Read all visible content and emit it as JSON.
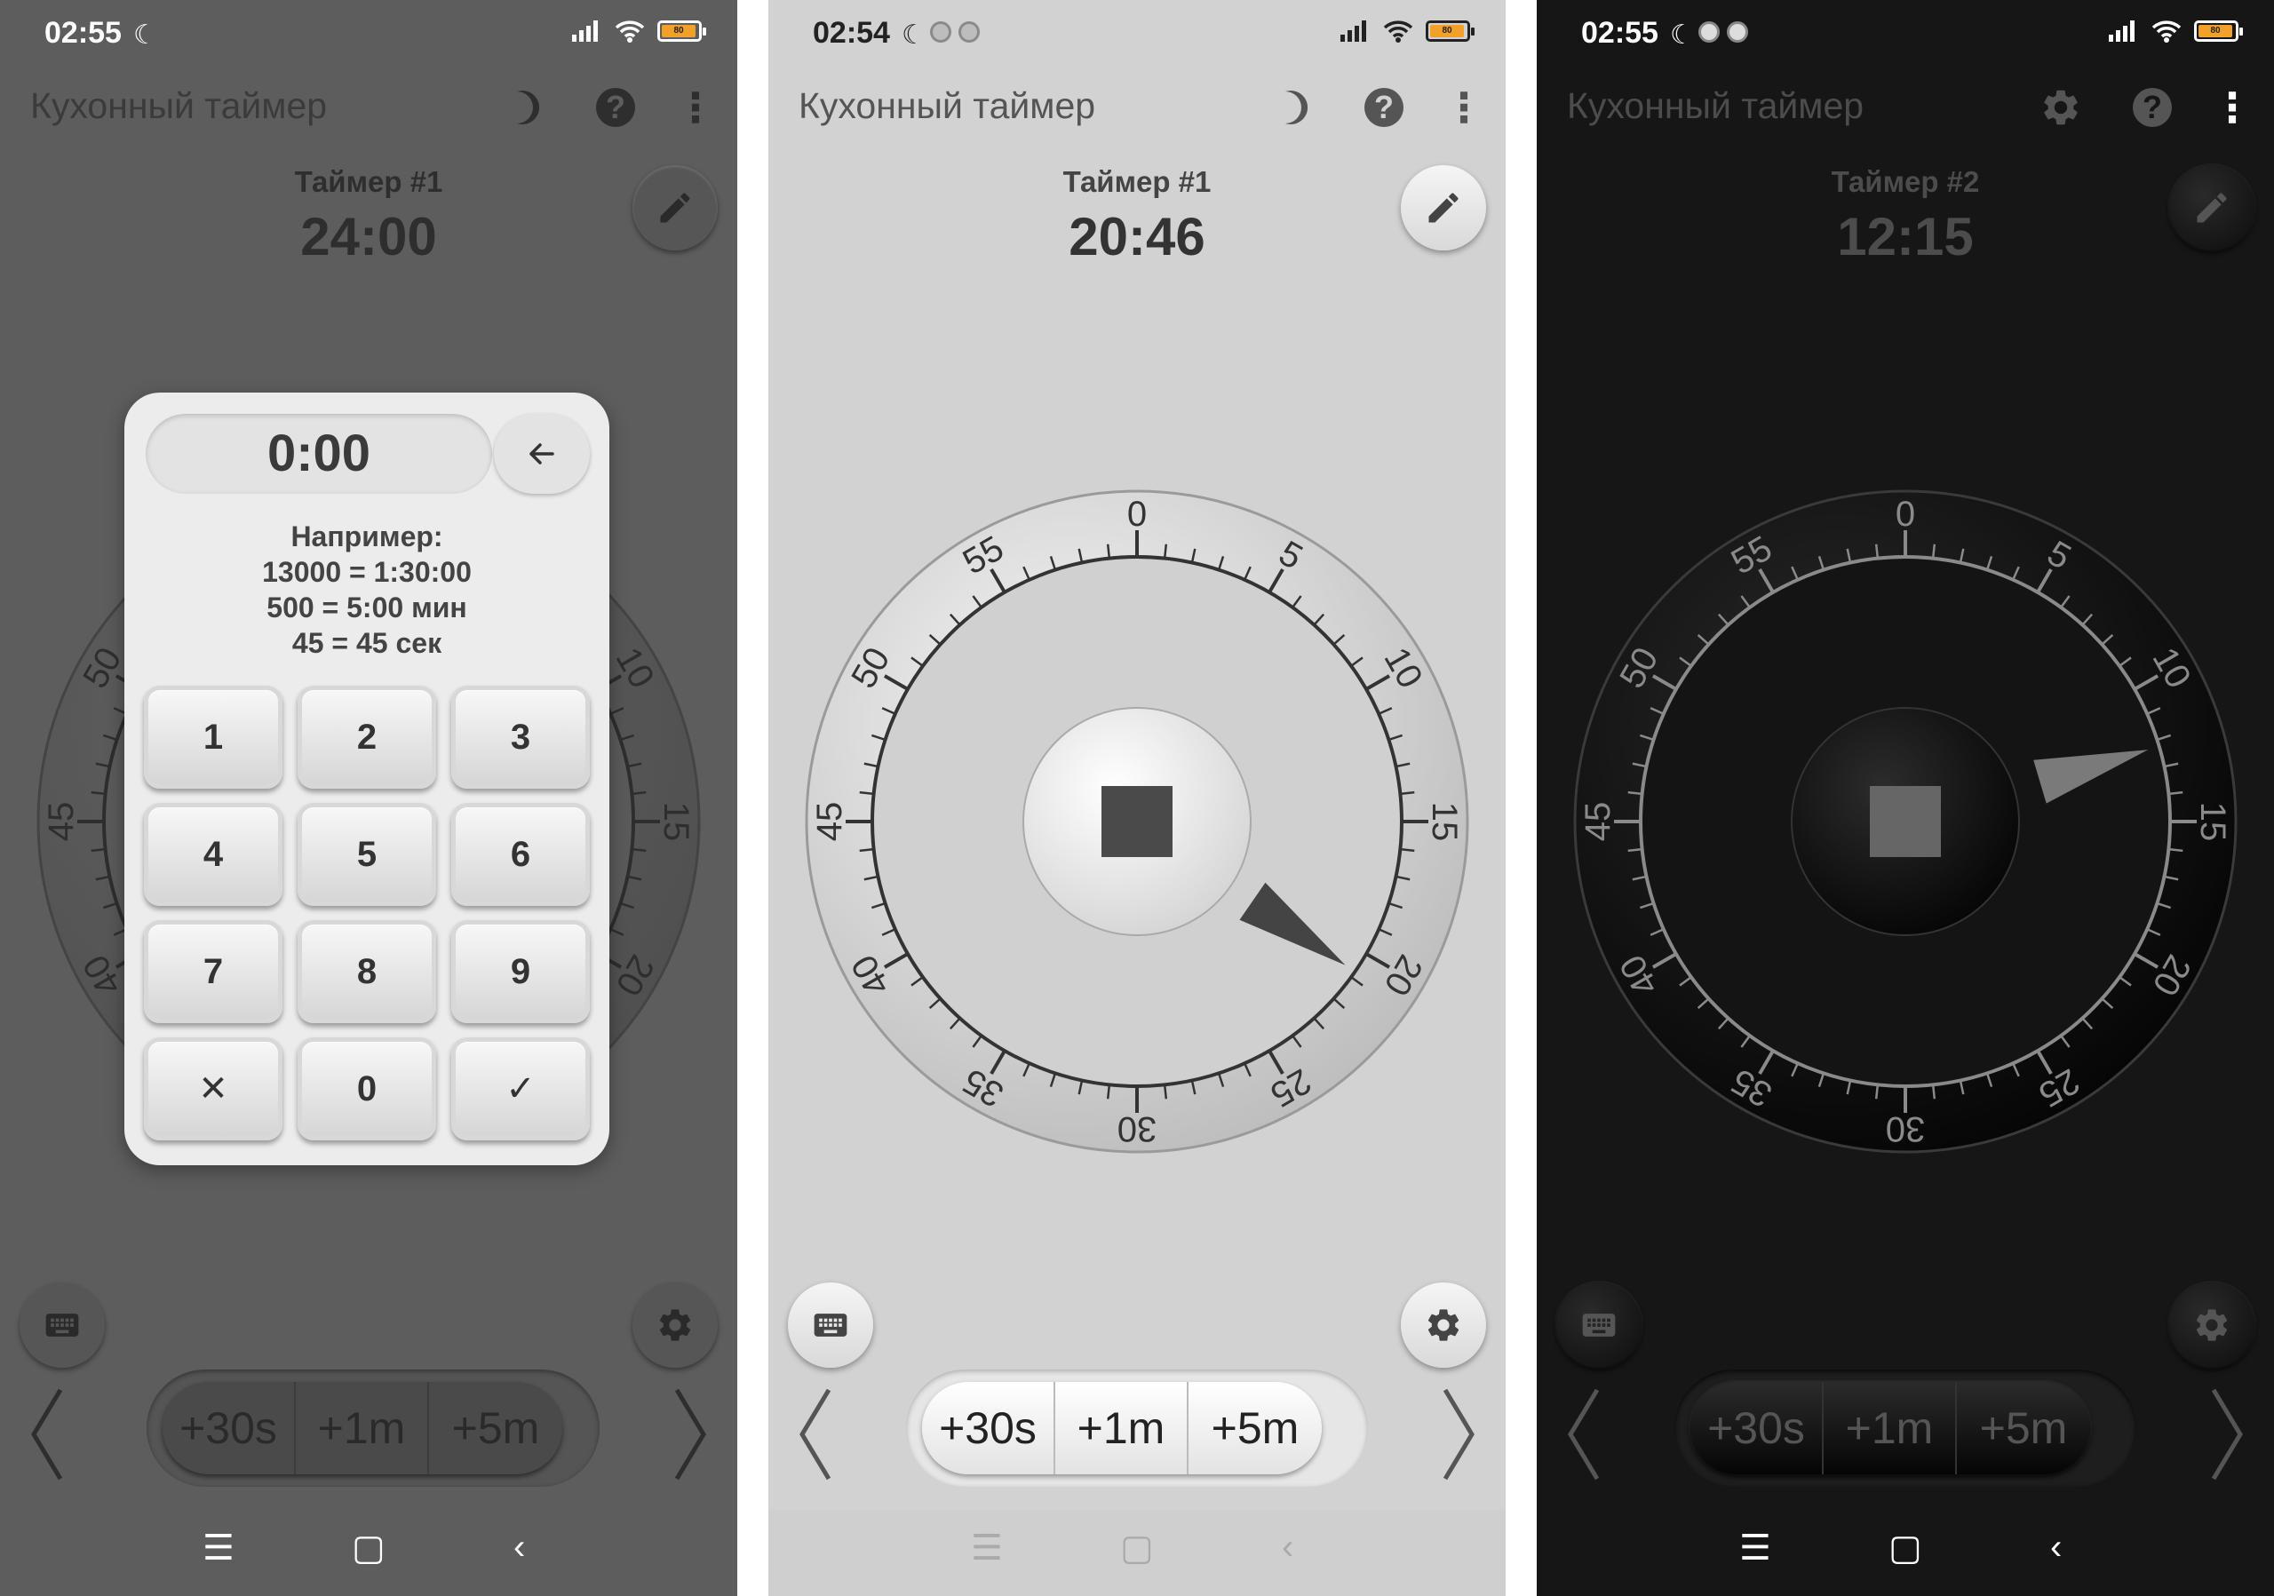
{
  "app_title": "Кухонный таймер",
  "phones": [
    {
      "status_time": "02:55",
      "battery": "80",
      "timer_name": "Таймер #1",
      "timer_time": "24:00"
    },
    {
      "status_time": "02:54",
      "battery": "80",
      "timer_name": "Таймер #1",
      "timer_time": "20:46"
    },
    {
      "status_time": "02:55",
      "battery": "80",
      "timer_name": "Таймер #2",
      "timer_time": "12:15"
    }
  ],
  "keypad": {
    "display": "0:00",
    "hint": [
      "Например:",
      "13000 = 1:30:00",
      "500 = 5:00 мин",
      "45 = 45 сек"
    ],
    "keys": [
      "1",
      "2",
      "3",
      "4",
      "5",
      "6",
      "7",
      "8",
      "9",
      "✕",
      "0",
      "✓"
    ]
  },
  "dial_labels": [
    "0",
    "5",
    "10",
    "15",
    "20",
    "25",
    "30",
    "35",
    "40",
    "45",
    "50",
    "55"
  ],
  "quick_add": {
    "b30s": "+30s",
    "b1m": "+1m",
    "b5m": "+5m"
  },
  "icons": {
    "moon": "moon-icon",
    "help": "help-icon",
    "more": "more-vert-icon",
    "edit": "pencil-icon",
    "keyboard": "keyboard-icon",
    "settings": "gear-icon",
    "stop": "stop-icon"
  },
  "colors": {
    "theme_gray_bg": "#5d5d5d",
    "theme_light_bg": "#d2d2d2",
    "theme_dark_bg": "#161616"
  }
}
